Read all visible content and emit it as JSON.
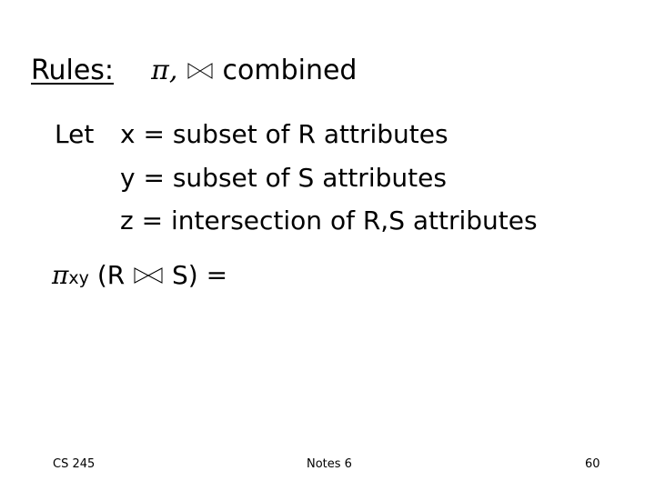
{
  "slide": {
    "title": {
      "label": "Rules:",
      "pi": "π,",
      "suffix": "combined",
      "join_icon": "bowtie-join-icon"
    },
    "definitions": {
      "let": "Let",
      "lines": [
        "x = subset of R attributes",
        "y = subset of S attributes",
        "z = intersection of R,S attributes"
      ]
    },
    "formula": {
      "pi": "π",
      "subscript": "xy",
      "open": "(R",
      "close": "S)",
      "equals": "="
    },
    "footer": {
      "left": "CS 245",
      "center": "Notes 6",
      "right": "60"
    }
  }
}
